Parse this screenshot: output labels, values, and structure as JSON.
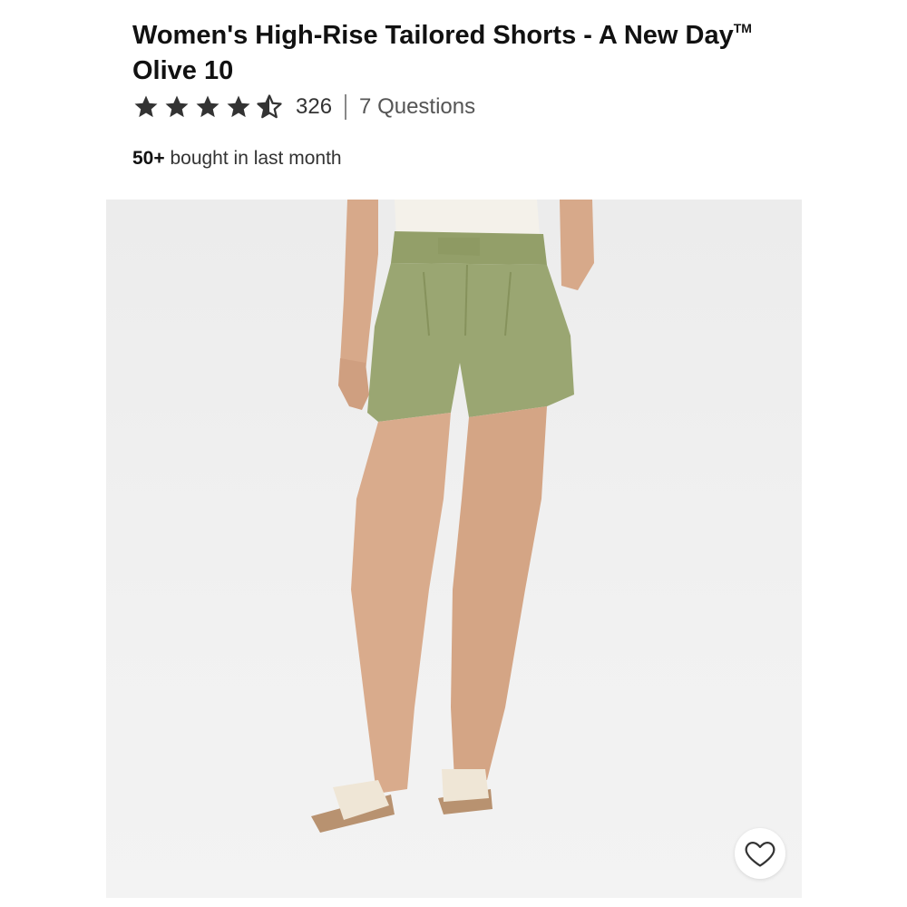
{
  "product": {
    "title": "Women's High-Rise Tailored Shorts - A New Day",
    "trademark": "TM",
    "variant": "Olive 10",
    "rating": 4.5,
    "rating_max": 5,
    "review_count": "326",
    "questions_label": "7 Questions",
    "bought_count": "50+",
    "bought_text": "bought in last month"
  },
  "icons": {
    "star": "star-icon",
    "favorite": "heart-icon"
  },
  "colors": {
    "star": "#333333",
    "shorts": "#9aa672",
    "background": "#efefef"
  }
}
